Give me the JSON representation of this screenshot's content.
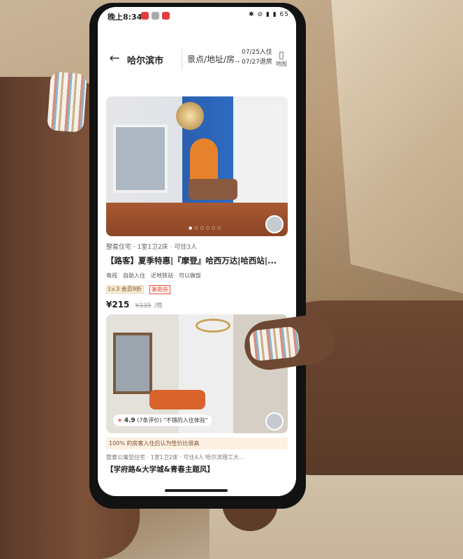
{
  "status_bar": {
    "time": "晚上8:34",
    "right_icons": "✱ ⊘ ▮ ▮ 65"
  },
  "search": {
    "city": "哈尔滨市",
    "keyword": "景点/地址/房...",
    "checkin": "07/25入住",
    "checkout": "07/27退房",
    "map_label": "地图"
  },
  "listings": [
    {
      "meta": "整套住宅 · 1室1卫2床 · 可住3人",
      "title": "【路客】夏季特惠|『摩登』哈西万达|哈西站|...",
      "tags": [
        "电视",
        "自助入住",
        "近地铁站",
        "可以做饭"
      ],
      "level_tag": "Lv.3 会员9折",
      "coupon_tag": "暑期券",
      "price": "¥215",
      "old_price": "¥335",
      "price_unit": "/晚"
    },
    {
      "rating": "4.9",
      "rating_note": "(7条评价)",
      "review_quote": "\"不错的入住体验\"",
      "banner": "100% 的房客入住后认为性价比很高",
      "meta": "整套公寓型住宅 · 1室1卫2床 · 可住4人",
      "location": "哈尔滨理工大...",
      "title": "【学府路&大学城&青春主题风】"
    }
  ],
  "icons": [
    "back-arrow-icon",
    "map-icon",
    "heart-icon",
    "star-icon"
  ]
}
